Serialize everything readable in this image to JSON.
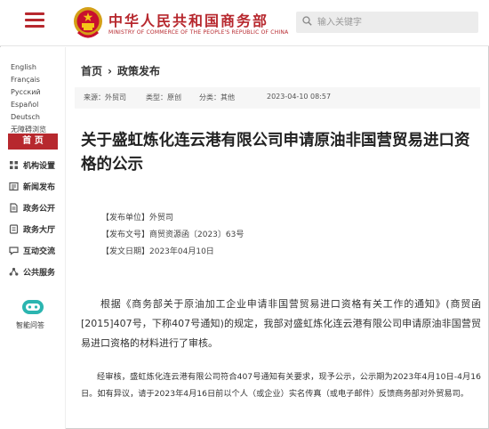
{
  "header": {
    "site_name_cn": "中华人民共和国商务部",
    "site_name_en": "MINISTRY OF COMMERCE OF THE PEOPLE'S REPUBLIC OF CHINA",
    "search_placeholder": "输入关键字",
    "accent_color": "#b7282e"
  },
  "languages": {
    "row1": [
      "English",
      "Français"
    ],
    "row2": [
      "Русский",
      "Español"
    ],
    "row3": [
      "Deutsch"
    ],
    "row4": [
      "无障碍浏览"
    ]
  },
  "sidebar": {
    "home": "首 页",
    "items": [
      {
        "label": "机构设置",
        "icon": "org-icon"
      },
      {
        "label": "新闻发布",
        "icon": "news-icon"
      },
      {
        "label": "政务公开",
        "icon": "document-icon"
      },
      {
        "label": "政务大厅",
        "icon": "service-hall-icon"
      },
      {
        "label": "互动交流",
        "icon": "chat-icon"
      },
      {
        "label": "公共服务",
        "icon": "public-service-icon"
      }
    ],
    "assistant_label": "智能问答"
  },
  "breadcrumb": {
    "home": "首页",
    "separator": "›",
    "current": "政策发布"
  },
  "meta": {
    "source": "来源：外贸司",
    "type": "类型：原创",
    "category": "分类：其他",
    "datetime": "2023-04-10 08:57"
  },
  "article": {
    "title": "关于盛虹炼化连云港有限公司申请原油非国营贸易进口资格的公示",
    "issuer": "【发布单位】外贸司",
    "doc_number": "【发布文号】商贸资源函〔2023〕63号",
    "issue_date": "【发文日期】2023年04月10日",
    "paragraph1": "根据《商务部关于原油加工企业申请非国营贸易进口资格有关工作的通知》(商贸函[2015]407号，下称407号通知)的规定，我部对盛虹炼化连云港有限公司申请原油非国营贸易进口资格的材料进行了审核。",
    "paragraph2": "经审核，盛虹炼化连云港有限公司符合407号通知有关要求，现予公示，公示期为2023年4月10日-4月16日。如有异议，请于2023年4月16日前以个人（或企业）实名传真（或电子邮件）反馈商务部对外贸易司。"
  }
}
